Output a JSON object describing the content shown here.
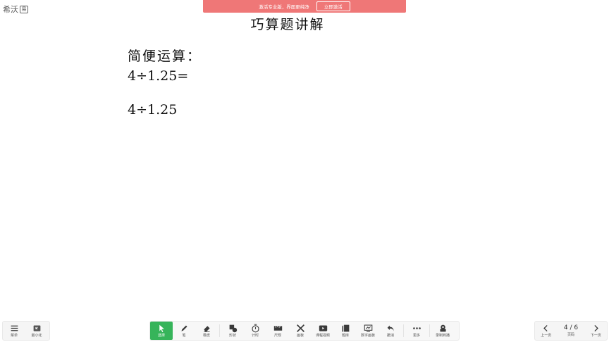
{
  "app": {
    "logo_text": "希沃",
    "logo_badge": "易"
  },
  "banner": {
    "message": "激活专业版，界面更纯净",
    "button_label": "立即激活"
  },
  "board": {
    "title": "巧算题讲解",
    "lines": [
      "简便运算：",
      "4÷1.25=",
      "4÷1.25"
    ]
  },
  "toolbar_left": [
    {
      "label": "菜单",
      "icon": "menu-icon"
    },
    {
      "label": "最小化",
      "icon": "minimize-icon"
    }
  ],
  "toolbar_center": [
    {
      "label": "选择",
      "icon": "cursor-icon",
      "active": true
    },
    {
      "label": "笔",
      "icon": "pen-icon"
    },
    {
      "label": "橡皮",
      "icon": "eraser-icon"
    },
    {
      "label": "形状",
      "icon": "shape-icon"
    },
    {
      "label": "计时",
      "icon": "timer-icon"
    },
    {
      "label": "尺规",
      "icon": "ruler-icon"
    },
    {
      "label": "画板",
      "icon": "drawing-board-icon"
    },
    {
      "label": "课程视频",
      "icon": "video-icon"
    },
    {
      "label": "题库",
      "icon": "question-bank-icon"
    },
    {
      "label": "数字画板",
      "icon": "digital-board-icon"
    },
    {
      "label": "撤消",
      "icon": "undo-icon"
    },
    {
      "label": "更多",
      "icon": "more-icon"
    },
    {
      "label": "录制到播",
      "icon": "record-icon"
    }
  ],
  "pager": {
    "prev_label": "上一页",
    "page_indicator": "4 / 6",
    "page_label": "页码",
    "next_label": "下一页"
  },
  "colors": {
    "banner": "#ef7777",
    "active_tool": "#36b45a",
    "toolbar_bg": "#f5f5f5"
  }
}
